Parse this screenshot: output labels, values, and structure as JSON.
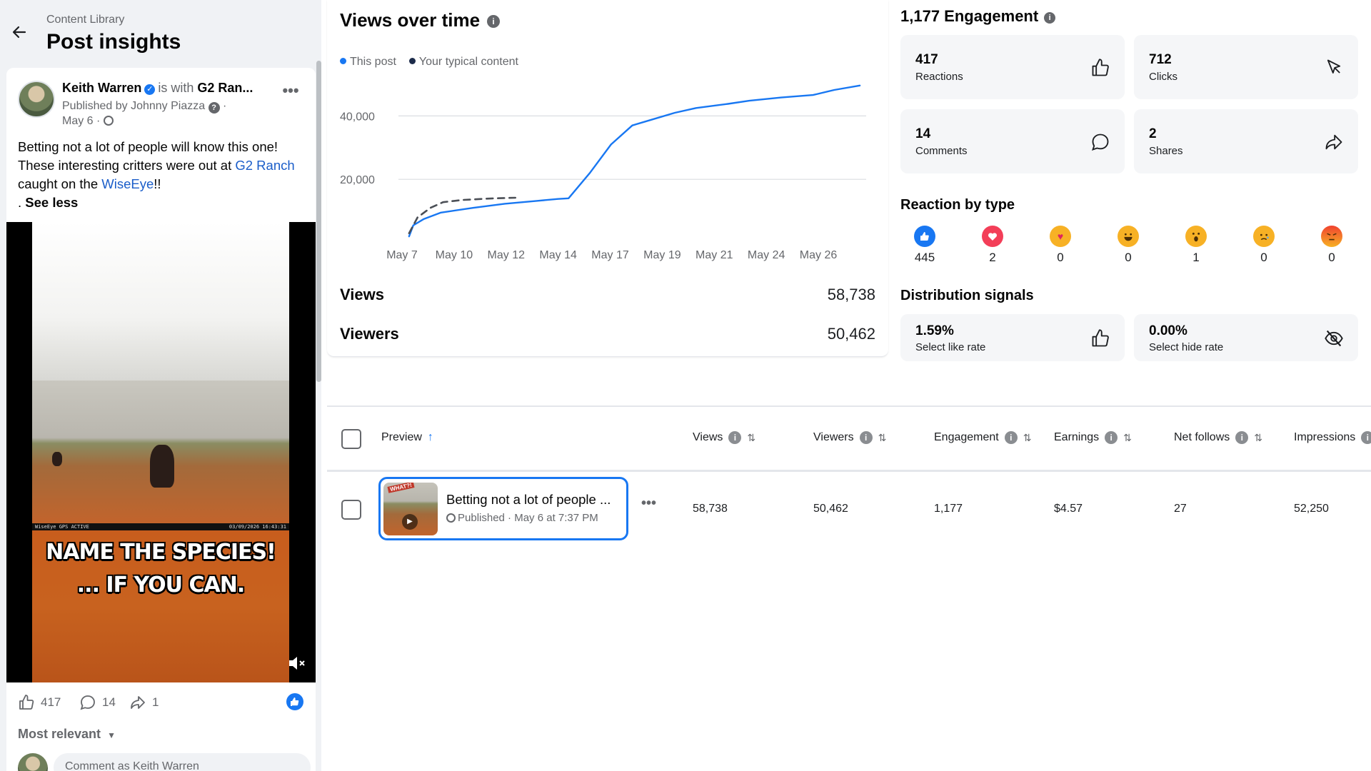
{
  "header": {
    "breadcrumb": "Content Library",
    "title": "Post insights"
  },
  "post": {
    "author": "Keith Warren",
    "with_text": "is with",
    "with_page": "G2 Ran...",
    "published_by": "Published by Johnny Piazza",
    "date": "May 6 ·",
    "text_part1": "Betting not a lot of people will know this one! These interesting critters were out at ",
    "link1": "G2 Ranch",
    "text_part2": " caught on the ",
    "link2": "WiseEye",
    "text_part3": "!!",
    "text_part4": ". ",
    "see_less": "See less",
    "video_caption_line1": "NAME THE SPECIES!",
    "video_caption_line2": "... IF YOU CAN.",
    "video_strip_left": "WiseEye  GPS ACTIVE",
    "video_strip_right": "03/09/2026 16:43:31",
    "reactions_count": "417",
    "comments_count": "14",
    "shares_count": "1",
    "most_relevant": "Most relevant",
    "comment_placeholder": "Comment as Keith Warren"
  },
  "views": {
    "title": "Views over time",
    "legend_this": "This post",
    "legend_typical": "Your typical content",
    "views_label": "Views",
    "views_value": "58,738",
    "viewers_label": "Viewers",
    "viewers_value": "50,462"
  },
  "chart_data": {
    "type": "line",
    "title": "Views over time",
    "xlabel": "",
    "ylabel": "",
    "x_tick_labels": [
      "May 7",
      "May 10",
      "May 12",
      "May 14",
      "May 17",
      "May 19",
      "May 21",
      "May 24",
      "May 26"
    ],
    "y_tick_labels": [
      "40,000",
      "20,000"
    ],
    "ylim": [
      0,
      50000
    ],
    "y_ticks": [
      20000,
      40000
    ],
    "grid": true,
    "legend": "top-left",
    "series": [
      {
        "name": "This post",
        "color": "#1877f2",
        "style": "solid",
        "x": [
          6.0,
          6.2,
          6.7,
          7.5,
          9,
          10.5,
          12,
          13,
          13.5,
          14.5,
          15.5,
          16.5,
          17.5,
          18.5,
          19.5,
          21,
          22,
          23.5,
          25,
          26,
          27.2
        ],
        "y": [
          2000,
          5500,
          7500,
          9500,
          11000,
          12300,
          13200,
          13800,
          14000,
          22000,
          31000,
          37000,
          39000,
          41000,
          42500,
          43800,
          44800,
          45800,
          46600,
          48200,
          49600
        ]
      },
      {
        "name": "Your typical content",
        "color": "#4b4f56",
        "style": "dashed",
        "x": [
          6.0,
          6.4,
          7.0,
          7.6,
          8.5,
          10.0,
          11.0
        ],
        "y": [
          3000,
          8000,
          11000,
          12800,
          13500,
          14000,
          14200
        ]
      }
    ]
  },
  "engagement": {
    "title": "1,177 Engagement",
    "reactions_value": "417",
    "reactions_label": "Reactions",
    "clicks_value": "712",
    "clicks_label": "Clicks",
    "comments_value": "14",
    "comments_label": "Comments",
    "shares_value": "2",
    "shares_label": "Shares"
  },
  "reaction_by_type": {
    "title": "Reaction by type",
    "items": [
      {
        "name": "like",
        "count": "445",
        "color": "#1877f2"
      },
      {
        "name": "love",
        "count": "2",
        "color": "#f33e58"
      },
      {
        "name": "care",
        "count": "0",
        "color": "#f7b125"
      },
      {
        "name": "haha",
        "count": "0",
        "color": "#f7b125"
      },
      {
        "name": "wow",
        "count": "1",
        "color": "#f7b125"
      },
      {
        "name": "sad",
        "count": "0",
        "color": "#f7b125"
      },
      {
        "name": "angry",
        "count": "0",
        "color": "#e9710f"
      }
    ]
  },
  "distribution": {
    "title": "Distribution signals",
    "like_rate_value": "1.59%",
    "like_rate_label": "Select like rate",
    "hide_rate_value": "0.00%",
    "hide_rate_label": "Select hide rate"
  },
  "table": {
    "headers": {
      "preview": "Preview",
      "views": "Views",
      "viewers": "Viewers",
      "engagement": "Engagement",
      "earnings": "Earnings",
      "net_follows": "Net follows",
      "impressions": "Impressions"
    },
    "rows": [
      {
        "title": "Betting not a lot of people ...",
        "status": "Published · May 6 at 7:37 PM",
        "thumb_tag": "WHAT?!",
        "views": "58,738",
        "viewers": "50,462",
        "engagement": "1,177",
        "earnings": "$4.57",
        "net_follows": "27",
        "impressions": "52,250"
      }
    ]
  }
}
